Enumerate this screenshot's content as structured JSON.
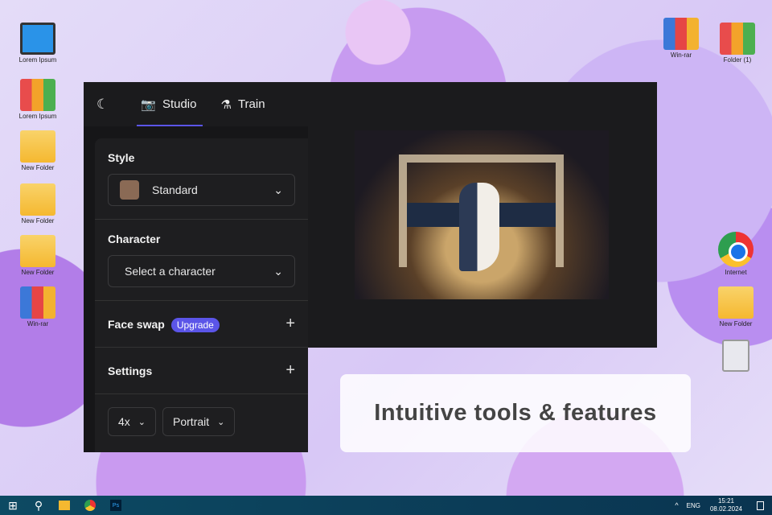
{
  "desktop": {
    "icons": [
      "Lorem Ipsum",
      "Lorem Ipsum",
      "New Folder",
      "New Folder",
      "New Folder",
      "Win-rar",
      "Win-rar",
      "Folder (1)",
      "Internet",
      "New Folder"
    ]
  },
  "app": {
    "tabs": [
      {
        "label": "Studio"
      },
      {
        "label": "Train"
      }
    ],
    "style": {
      "label": "Style",
      "value": "Standard"
    },
    "character": {
      "label": "Character",
      "placeholder": "Select a character"
    },
    "face_swap": {
      "label": "Face swap",
      "badge": "Upgrade"
    },
    "settings": {
      "label": "Settings",
      "scale": "4x",
      "orientation": "Portrait"
    }
  },
  "banner": "Intuitive tools & features",
  "taskbar": {
    "lang": "ENG",
    "time": "15:21",
    "date": "08.02.2024",
    "tray_arrow": "^"
  },
  "colors": {
    "accent": "#5b55e8"
  }
}
